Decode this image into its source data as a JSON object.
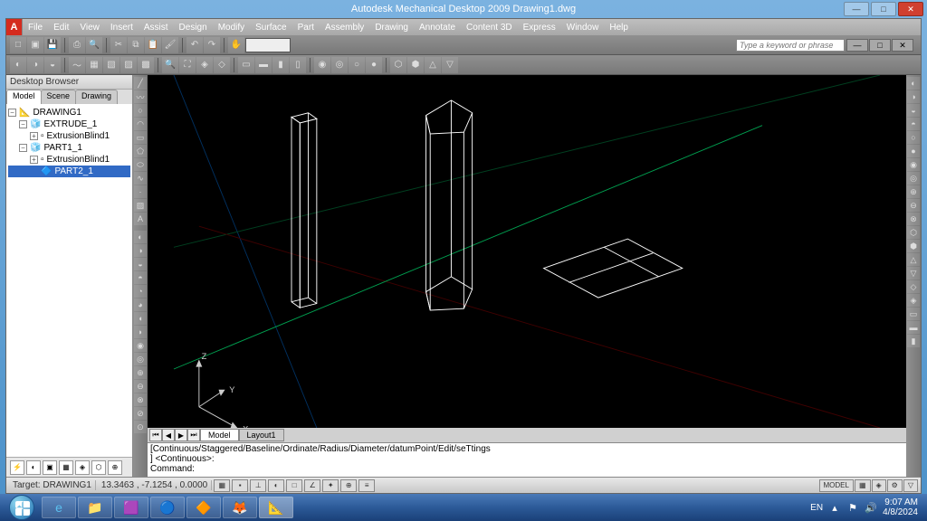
{
  "window": {
    "title": "Autodesk Mechanical Desktop 2009 Drawing1.dwg",
    "search_placeholder": "Type a keyword or phrase"
  },
  "menu": [
    "File",
    "Edit",
    "View",
    "Insert",
    "Assist",
    "Design",
    "Modify",
    "Surface",
    "Part",
    "Assembly",
    "Drawing",
    "Annotate",
    "Content 3D",
    "Express",
    "Window",
    "Help"
  ],
  "browser": {
    "title": "Desktop Browser",
    "tabs": [
      "Model",
      "Scene",
      "Drawing"
    ],
    "tree": {
      "root": "DRAWING1",
      "items": [
        {
          "label": "EXTRUDE_1",
          "indent": 1
        },
        {
          "label": "ExtrusionBlind1",
          "indent": 2
        },
        {
          "label": "PART1_1",
          "indent": 1
        },
        {
          "label": "ExtrusionBlind1",
          "indent": 2
        },
        {
          "label": "PART2_1",
          "indent": 3,
          "selected": true
        }
      ]
    }
  },
  "layout_tabs": [
    "Model",
    "Layout1"
  ],
  "command": {
    "line1": "[Continuous/Staggered/Baseline/Ordinate/Radius/Diameter/datumPoint/Edit/seTtings",
    "line2": "] <Continuous>:",
    "prompt": "Command:"
  },
  "status": {
    "target_label": "Target:",
    "target_value": "DRAWING1",
    "coords": "13.3463 , -7.1254 , 0.0000",
    "model_btn": "MODEL"
  },
  "axes": {
    "x": "X",
    "y": "Y",
    "z": "Z"
  },
  "taskbar": {
    "lang": "EN",
    "time": "9:07 AM",
    "date": "4/8/2024"
  }
}
